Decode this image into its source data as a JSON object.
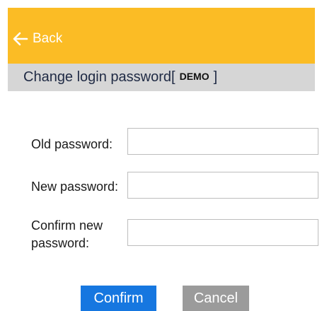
{
  "header": {
    "back_label": "Back",
    "back_icon": "arrow-left-icon",
    "background_color": "#fbbc25"
  },
  "subheader": {
    "title_prefix": "Change login password[",
    "username": "DEMO",
    "title_suffix": "]"
  },
  "form": {
    "old_password_label": "Old password:",
    "old_password_value": "",
    "new_password_label": "New password:",
    "new_password_value": "",
    "confirm_password_label_line1": "Confirm new",
    "confirm_password_label_line2": "password:",
    "confirm_password_value": ""
  },
  "buttons": {
    "confirm_label": "Confirm",
    "cancel_label": "Cancel",
    "confirm_color": "#1677e0",
    "cancel_color": "#9b9b9b"
  }
}
